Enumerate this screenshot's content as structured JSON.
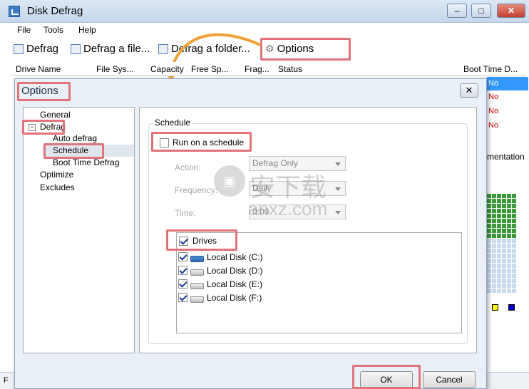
{
  "window": {
    "title": "Disk Defrag",
    "minimize": "‒",
    "maximize": "□",
    "close": "✕"
  },
  "menu": [
    "File",
    "Tools",
    "Help"
  ],
  "toolbar": {
    "defrag": "Defrag",
    "defrag_file": "Defrag a file...",
    "defrag_folder": "Defrag a folder...",
    "options": "Options"
  },
  "columns": [
    "Drive Name",
    "File Sys...",
    "Capacity",
    "Free Sp...",
    "Frag...",
    "Status",
    "Boot Time D..."
  ],
  "boot_time_values": [
    "No",
    "No",
    "No",
    "No"
  ],
  "right_fragment_label": "mentation",
  "dialog": {
    "title": "Options",
    "close": "✕",
    "tree": {
      "general": "General",
      "defrag": "Defrag",
      "auto_defrag": "Auto defrag",
      "schedule": "Schedule",
      "boot_time_defrag": "Boot Time Defrag",
      "optimize": "Optimize",
      "excludes": "Excludes",
      "expander": "−"
    },
    "group_title": "Schedule",
    "run_on_schedule": {
      "label": "Run on a schedule",
      "checked": false
    },
    "action": {
      "label": "Action:",
      "value": "Defrag Only"
    },
    "frequency": {
      "label": "Frequency:",
      "value": "Daily"
    },
    "time": {
      "label": "Time:",
      "value": "0:00"
    },
    "drives": {
      "header": "Drives",
      "header_checked": true,
      "items": [
        {
          "label": "Local Disk (C:)",
          "checked": true,
          "icon": "system-disk-icon"
        },
        {
          "label": "Local Disk (D:)",
          "checked": true,
          "icon": "disk-icon"
        },
        {
          "label": "Local Disk (E:)",
          "checked": true,
          "icon": "disk-icon"
        },
        {
          "label": "Local Disk (F:)",
          "checked": true,
          "icon": "disk-icon"
        }
      ]
    },
    "ok": "OK",
    "cancel": "Cancel"
  },
  "watermark": {
    "text1": "安下载",
    "text2": "anxz.com"
  },
  "colors": {
    "highlight": "#e2737b",
    "arrow": "#f0a23a",
    "boot_no": "#c00000",
    "selection": "#3399ff",
    "cluster_green": "#3a9a3a",
    "cluster_blue": "#c9d9ee"
  },
  "statusbar": {
    "left": "F"
  }
}
